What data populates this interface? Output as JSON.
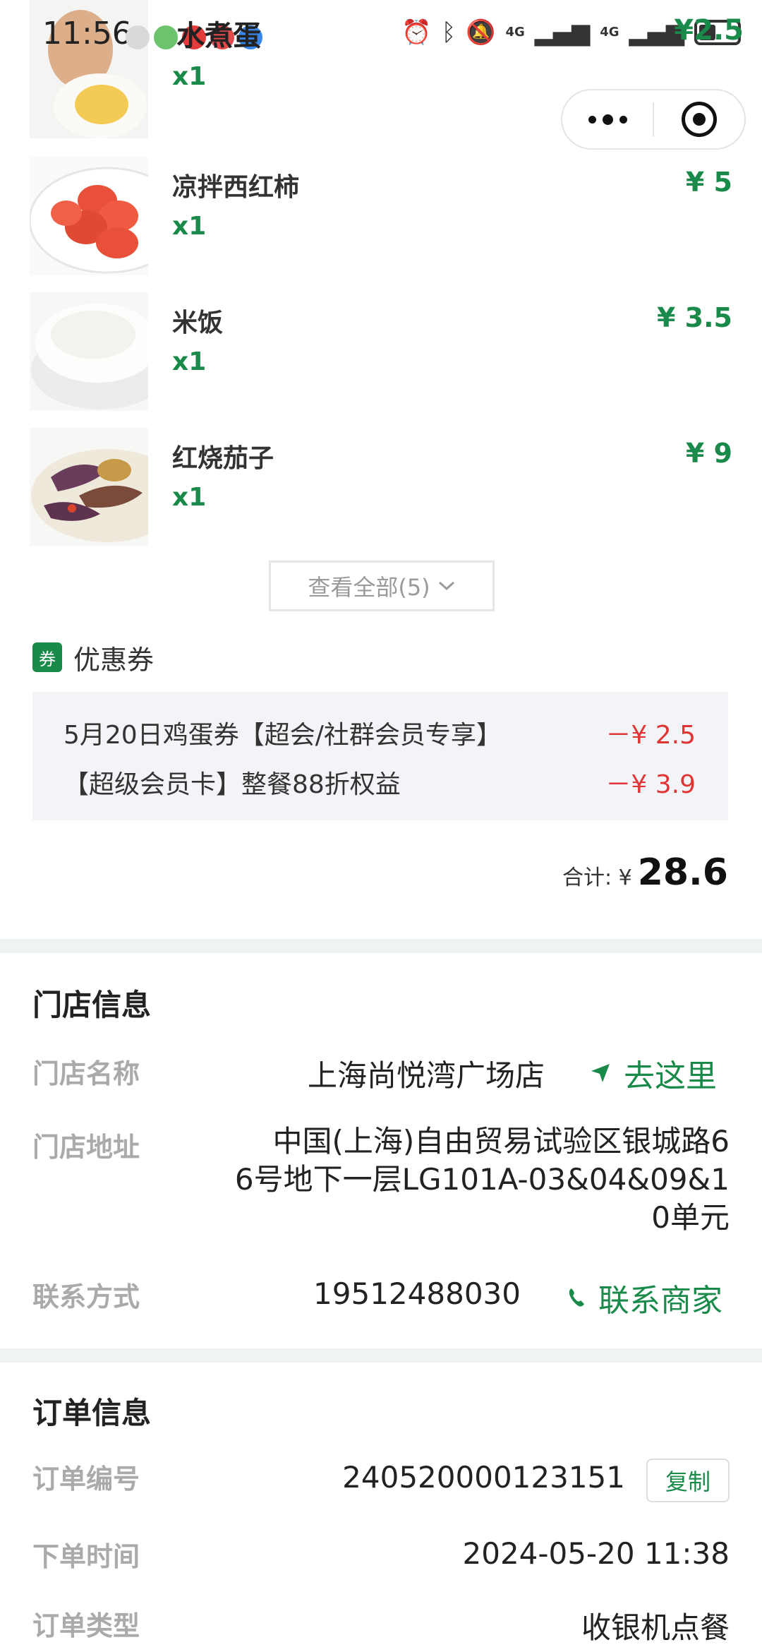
{
  "status_bar": {
    "time": "11:56",
    "app_name": "水煮蛋",
    "overlap_price": "¥2.5",
    "net1": "4G",
    "net2": "4G",
    "battery_level": 0.45
  },
  "dishes": [
    {
      "name": "",
      "qty": "x1",
      "price": "",
      "icon": "boiled-egg"
    },
    {
      "name": "凉拌西红柿",
      "qty": "x1",
      "price": "¥ 5",
      "icon": "tomato-salad"
    },
    {
      "name": "米饭",
      "qty": "x1",
      "price": "¥ 3.5",
      "icon": "rice"
    },
    {
      "name": "红烧茄子",
      "qty": "x1",
      "price": "¥ 9",
      "icon": "braised-eggplant"
    }
  ],
  "view_all": {
    "label": "查看全部(5)"
  },
  "coupons": {
    "badge": "券",
    "title": "优惠券",
    "items": [
      {
        "name": "5月20日鸡蛋券【超会/社群会员专享】",
        "amount": "－¥ 2.5"
      },
      {
        "name": "【超级会员卡】整餐88折权益",
        "amount": "－¥ 3.9"
      }
    ]
  },
  "total": {
    "label": "合计: ¥",
    "value": "28.6"
  },
  "store": {
    "title": "门店信息",
    "name_label": "门店名称",
    "name": "上海尚悦湾广场店",
    "go_label": "去这里",
    "address_label": "门店地址",
    "address_lines": [
      "中国(上海)自由贸易试验区银城路6",
      "6号地下一层LG101A-03&04&09&1",
      "0单元"
    ],
    "contact_label": "联系方式",
    "phone": "19512488030",
    "contact_action": "联系商家"
  },
  "order": {
    "title": "订单信息",
    "no_label": "订单编号",
    "no": "240520000123151",
    "copy_label": "复制",
    "time_label": "下单时间",
    "time": "2024-05-20 11:38",
    "type_label": "订单类型",
    "type": "收银机点餐"
  },
  "colors": {
    "accent": "#1a8a4a",
    "discount": "#e03535"
  }
}
